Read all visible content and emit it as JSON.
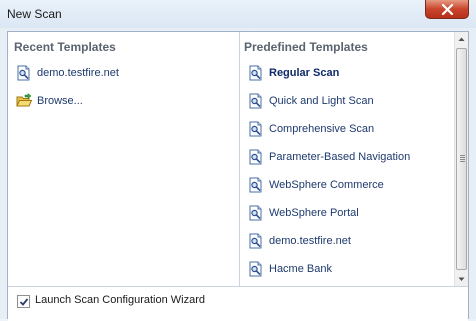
{
  "window": {
    "title": "New Scan"
  },
  "recent": {
    "heading": "Recent Templates",
    "items": [
      {
        "label": "demo.testfire.net",
        "icon": "scan-template-icon"
      },
      {
        "label": "Browse...",
        "icon": "folder-open-icon"
      }
    ]
  },
  "predefined": {
    "heading": "Predefined Templates",
    "selected_index": 0,
    "items": [
      {
        "label": "Regular Scan"
      },
      {
        "label": "Quick and Light Scan"
      },
      {
        "label": "Comprehensive Scan"
      },
      {
        "label": "Parameter-Based Navigation"
      },
      {
        "label": "WebSphere Commerce"
      },
      {
        "label": "WebSphere Portal"
      },
      {
        "label": "demo.testfire.net"
      },
      {
        "label": "Hacme Bank"
      }
    ]
  },
  "footer": {
    "wizard_checkbox_label": "Launch Scan Configuration Wizard",
    "wizard_checked": true
  },
  "colors": {
    "link_text": "#1e3a6e",
    "close_button": "#c8452c",
    "heading": "#5a6470"
  }
}
